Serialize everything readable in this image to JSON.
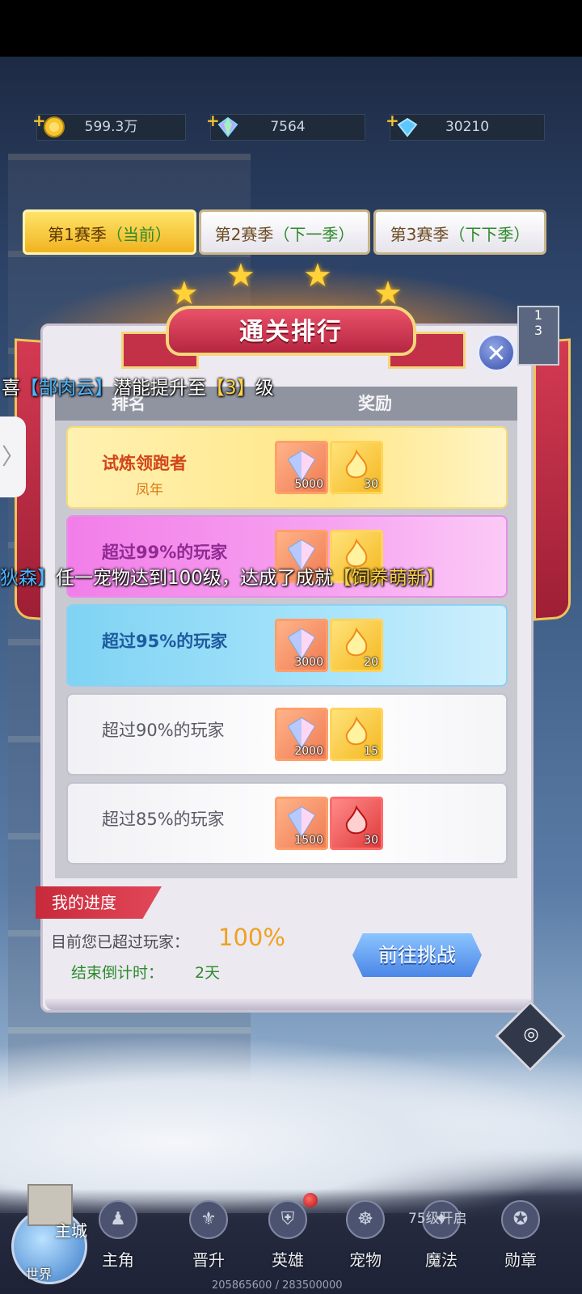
{
  "resources": [
    {
      "icon": "gold-coin-icon",
      "value": "599.3万"
    },
    {
      "icon": "rainbow-gem-icon",
      "value": "7564"
    },
    {
      "icon": "blue-diamond-icon",
      "value": "30210"
    }
  ],
  "tabs": [
    {
      "label": "第1赛季",
      "sub": "（当前）",
      "active": true
    },
    {
      "label": "第2赛季",
      "sub": "（下一季）",
      "active": false
    },
    {
      "label": "第3赛季",
      "sub": "（下下季）",
      "active": false
    }
  ],
  "panel": {
    "title": "通关排行",
    "columns": {
      "rank": "排名",
      "reward": "奖励"
    },
    "rows": [
      {
        "title": "试炼领跑者",
        "subtitle": "凤年",
        "gem": "5000",
        "fire": "30"
      },
      {
        "title": "超过99%的玩家",
        "gem": "",
        "fire": ""
      },
      {
        "title": "超过95%的玩家",
        "gem": "3000",
        "fire": "20"
      },
      {
        "title": "超过90%的玩家",
        "gem": "2000",
        "fire": "15"
      },
      {
        "title": "超过85%的玩家",
        "gem": "1500",
        "fire": "30"
      }
    ],
    "my_progress_label": "我的进度",
    "surpass_label": "目前您已超过玩家：",
    "surpass_value": "100%",
    "countdown_label": "结束倒计时：",
    "countdown_value": "2天",
    "challenge_button": "前往挑战"
  },
  "broadcasts": {
    "line1": {
      "pre": "喜",
      "name": "【郜肉云】",
      "mid": "潜能提升至",
      "level": "【3】",
      "post": "级"
    },
    "line2": {
      "name": "狄森】",
      "mid": "任一宠物达到100级，达成了成就",
      "achv": "【饲养萌新】"
    }
  },
  "side": {
    "expand_glyph": "〉",
    "box_top": "1",
    "box_bottom": "3",
    "compass_glyph": "◎"
  },
  "nav": {
    "world_main": "主城",
    "world_label": "世界",
    "items": [
      {
        "label": "主角",
        "icon": "hero-icon"
      },
      {
        "label": "晋升",
        "icon": "promote-icon"
      },
      {
        "label": "英雄",
        "icon": "helmet-icon"
      },
      {
        "label": "宠物",
        "icon": "pet-icon"
      },
      {
        "label": "魔法",
        "icon": "magic-icon"
      },
      {
        "label": "勋章",
        "icon": "medal-icon"
      }
    ],
    "locked_text": "75级开启",
    "exp_text": "205865600 / 283500000"
  },
  "colors": {
    "accent_gold": "#f1b320",
    "ribbon_red": "#b62640",
    "progress_value": "#f0a020",
    "green_text": "#2c8a2c"
  }
}
